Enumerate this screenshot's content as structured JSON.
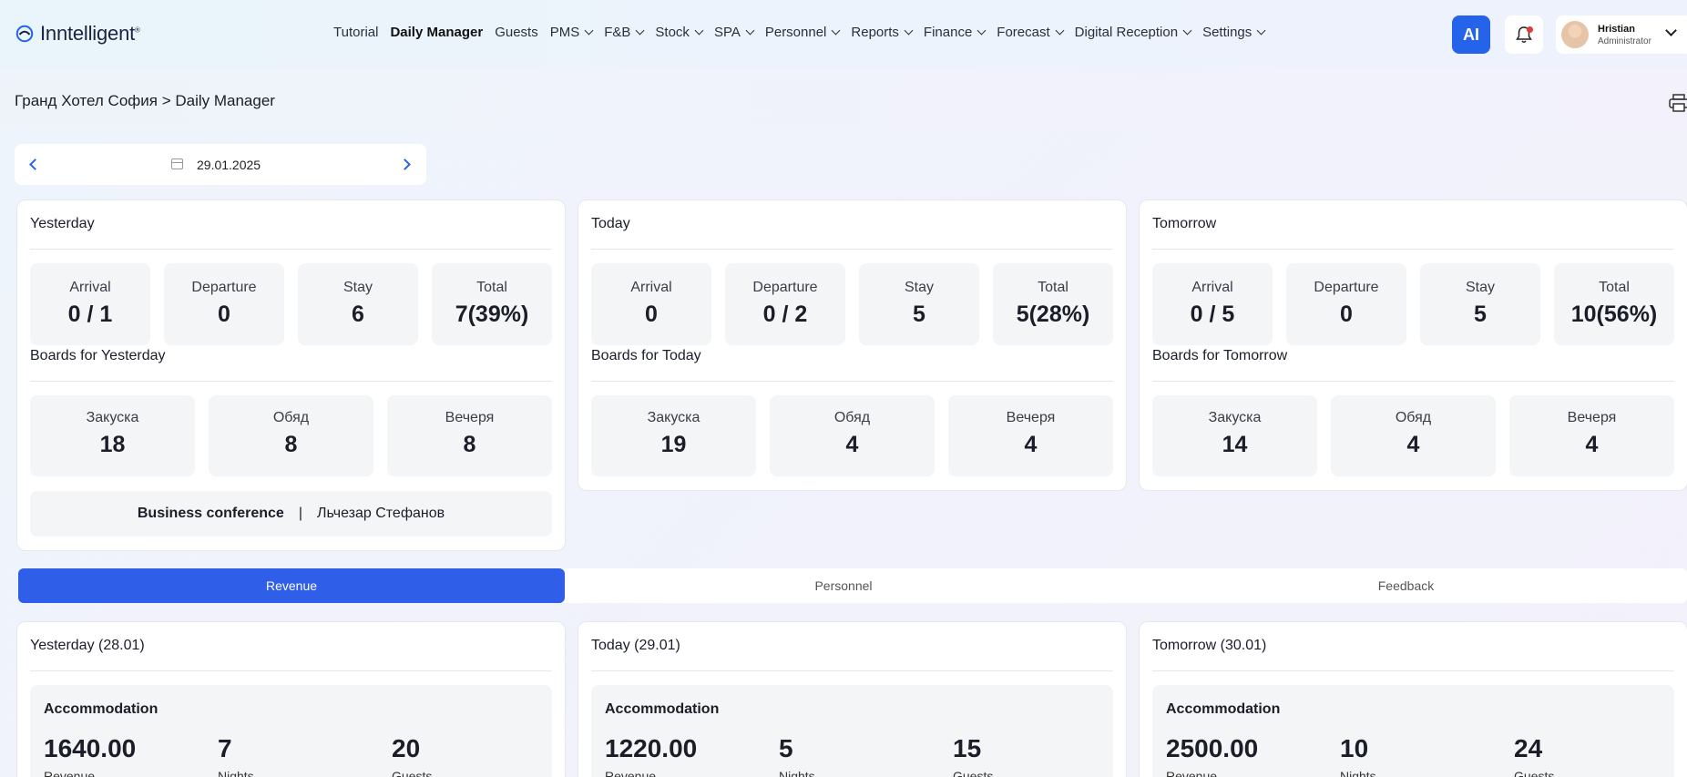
{
  "app": {
    "logo_text": "Inntelligent",
    "logo_tm": "®"
  },
  "nav": [
    {
      "label": "Tutorial",
      "dropdown": false,
      "active": false
    },
    {
      "label": "Daily Manager",
      "dropdown": false,
      "active": true
    },
    {
      "label": "Guests",
      "dropdown": false,
      "active": false
    },
    {
      "label": "PMS",
      "dropdown": true,
      "active": false
    },
    {
      "label": "F&B",
      "dropdown": true,
      "active": false
    },
    {
      "label": "Stock",
      "dropdown": true,
      "active": false
    },
    {
      "label": "SPA",
      "dropdown": true,
      "active": false
    },
    {
      "label": "Personnel",
      "dropdown": true,
      "active": false
    },
    {
      "label": "Reports",
      "dropdown": true,
      "active": false
    },
    {
      "label": "Finance",
      "dropdown": true,
      "active": false
    },
    {
      "label": "Forecast",
      "dropdown": true,
      "active": false
    },
    {
      "label": "Digital Reception",
      "dropdown": true,
      "active": false
    },
    {
      "label": "Settings",
      "dropdown": true,
      "active": false
    }
  ],
  "header": {
    "ai_label": "AI",
    "user_name": "Hristian",
    "user_role": "Administrator"
  },
  "breadcrumb": "Гранд Хотел София > Daily Manager",
  "datepicker": {
    "date": "29.01.2025"
  },
  "days": [
    {
      "title": "Yesterday",
      "stats": [
        {
          "label": "Arrival",
          "value": "0 / 1"
        },
        {
          "label": "Departure",
          "value": "0"
        },
        {
          "label": "Stay",
          "value": "6"
        },
        {
          "label": "Total",
          "value": "7(39%)"
        }
      ],
      "boards_title": "Boards for Yesterday",
      "boards": [
        {
          "label": "Закуска",
          "value": "18"
        },
        {
          "label": "Обяд",
          "value": "8"
        },
        {
          "label": "Вечеря",
          "value": "8"
        }
      ],
      "event": {
        "name": "Business conference",
        "separator": "|",
        "person": "Льчезар Стефанов"
      }
    },
    {
      "title": "Today",
      "stats": [
        {
          "label": "Arrival",
          "value": "0"
        },
        {
          "label": "Departure",
          "value": "0 / 2"
        },
        {
          "label": "Stay",
          "value": "5"
        },
        {
          "label": "Total",
          "value": "5(28%)"
        }
      ],
      "boards_title": "Boards for Today",
      "boards": [
        {
          "label": "Закуска",
          "value": "19"
        },
        {
          "label": "Обяд",
          "value": "4"
        },
        {
          "label": "Вечеря",
          "value": "4"
        }
      ]
    },
    {
      "title": "Tomorrow",
      "stats": [
        {
          "label": "Arrival",
          "value": "0 / 5"
        },
        {
          "label": "Departure",
          "value": "0"
        },
        {
          "label": "Stay",
          "value": "5"
        },
        {
          "label": "Total",
          "value": "10(56%)"
        }
      ],
      "boards_title": "Boards for Tomorrow",
      "boards": [
        {
          "label": "Закуска",
          "value": "14"
        },
        {
          "label": "Обяд",
          "value": "4"
        },
        {
          "label": "Вечеря",
          "value": "4"
        }
      ]
    }
  ],
  "tabs": [
    {
      "label": "Revenue",
      "active": true
    },
    {
      "label": "Personnel",
      "active": false
    },
    {
      "label": "Feedback",
      "active": false
    }
  ],
  "revenue": [
    {
      "title": "Yesterday (28.01)",
      "section": "Accommodation",
      "revenue": "1640.00",
      "revenue_label": "Revenue",
      "nights": "7",
      "nights_label": "Nights",
      "guests": "20",
      "guests_label": "Guests"
    },
    {
      "title": "Today (29.01)",
      "section": "Accommodation",
      "revenue": "1220.00",
      "revenue_label": "Revenue",
      "nights": "5",
      "nights_label": "Nights",
      "guests": "15",
      "guests_label": "Guests"
    },
    {
      "title": "Tomorrow (30.01)",
      "section": "Accommodation",
      "revenue": "2500.00",
      "revenue_label": "Revenue",
      "nights": "10",
      "nights_label": "Nights",
      "guests": "24",
      "guests_label": "Guests"
    }
  ],
  "colors": {
    "accent": "#2563eb",
    "tab_active": "#2f5fe8",
    "notification": "#e53935"
  }
}
